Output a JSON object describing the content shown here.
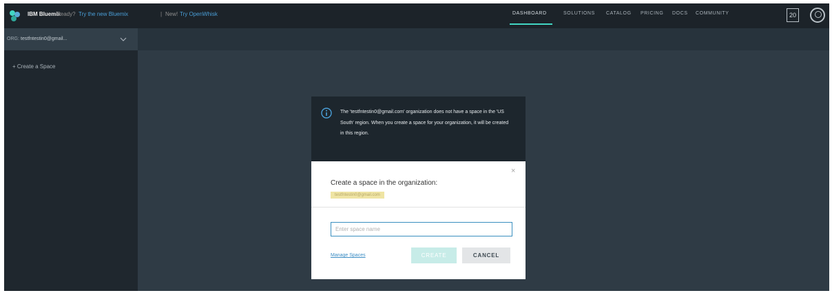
{
  "header": {
    "brand": "IBM Bluemix",
    "promo_text": "Ready?",
    "promo_link": "Try the new Bluemix",
    "separator": "|",
    "new_text": "New!",
    "new_link": "Try OpenWhisk",
    "nav": [
      "DASHBOARD",
      "SOLUTIONS",
      "CATALOG",
      "PRICING",
      "DOCS",
      "COMMUNITY"
    ],
    "active_nav": "DASHBOARD",
    "calendar_day": "20",
    "accent_color": "#41d6c3"
  },
  "org_bar": {
    "label": "ORG:",
    "value": "testfntestin0@gmail..."
  },
  "sidebar": {
    "items": [
      "+ Create a Space"
    ]
  },
  "notice": {
    "text": "The 'testfntestin0@gmail.com' organization does not have a space in the 'US South' region. When you create a space for your organization, it will be created in this region."
  },
  "modal": {
    "title": "Create a space in the organization:",
    "org_name": "testfntestin0@gmail.com",
    "input_placeholder": "Enter space name",
    "input_value": "",
    "manage_link": "Manage Spaces",
    "create_label": "CREATE",
    "cancel_label": "CANCEL",
    "close_glyph": "×"
  }
}
